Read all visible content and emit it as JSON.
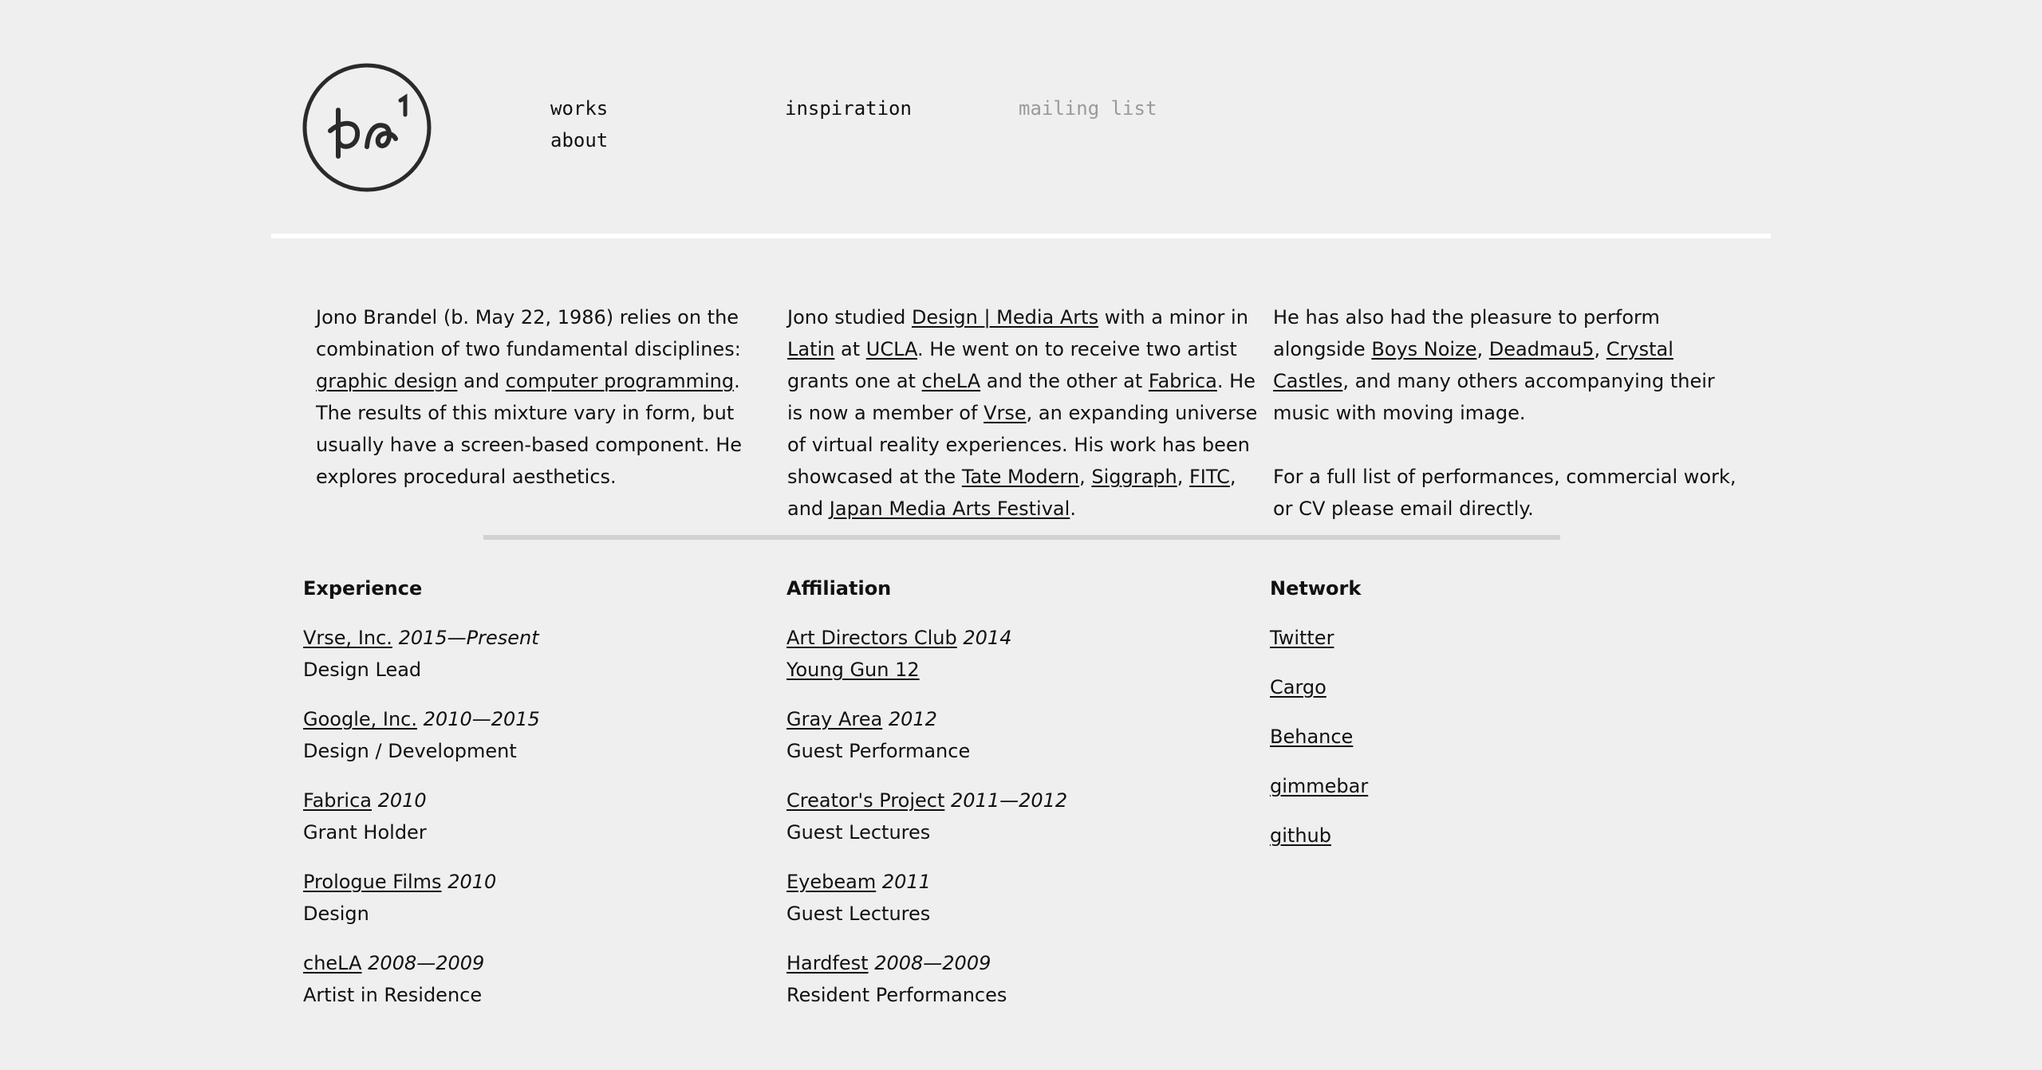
{
  "logo": {
    "icon": "circle-monogram-logo"
  },
  "nav": {
    "works": "works",
    "about": "about",
    "inspiration": "inspiration",
    "mailing_list": "mailing list"
  },
  "intro": {
    "col1": {
      "t1": "Jono Brandel (b. May 22, 1986) relies on the combination of two fundamental disciplines: ",
      "link_graphic_design": "graphic design",
      "t2": " and ",
      "link_computer_programming": "computer programming",
      "t3": ". The results of this mixture vary in form, but usually have a screen-based component. He explores procedural aesthetics."
    },
    "col2": {
      "t1": "Jono studied ",
      "link_design_media_arts": "Design | Media Arts",
      "t2": " with a minor in ",
      "link_latin": "Latin",
      "t3": " at ",
      "link_ucla": "UCLA",
      "t4": ". He went on to receive two artist grants one at ",
      "link_chela": "cheLA",
      "t5": " and the other at ",
      "link_fabrica": "Fabrica",
      "t6": ". He is now a member of ",
      "link_vrse": "Vrse",
      "t7": ", an expanding universe of virtual reality experiences. His work has been showcased at the ",
      "link_tate_modern": "Tate Modern",
      "t8": ", ",
      "link_siggraph": "Siggraph",
      "t9": ", ",
      "link_fitc": "FITC",
      "t10": ", and ",
      "link_japan_media_arts": "Japan Media Arts Festival",
      "t11": "."
    },
    "col3": {
      "t1": "He has also had the pleasure to perform alongside ",
      "link_boys_noize": "Boys Noize",
      "t2": ", ",
      "link_deadmau5": "Deadmau5",
      "t3": ", ",
      "link_crystal_castles": "Crystal Castles",
      "t4": ", and many others accompanying their music with moving image.",
      "p2": "For a full list of performances, commercial work, or CV please email directly."
    }
  },
  "experience": {
    "heading": "Experience",
    "items": [
      {
        "name": "Vrse, Inc.",
        "years": "2015—Present",
        "role": "Design Lead"
      },
      {
        "name": "Google, Inc.",
        "years": "2010—2015",
        "role": "Design / Development"
      },
      {
        "name": "Fabrica",
        "years": "2010",
        "role": "Grant Holder"
      },
      {
        "name": "Prologue Films",
        "years": "2010",
        "role": "Design"
      },
      {
        "name": "cheLA",
        "years": "2008—2009",
        "role": "Artist in Residence"
      }
    ]
  },
  "affiliation": {
    "heading": "Affiliation",
    "items": [
      {
        "name": "Art Directors Club",
        "years": "2014",
        "role": "Young Gun 12",
        "role_is_link": true
      },
      {
        "name": "Gray Area",
        "years": "2012",
        "role": "Guest Performance"
      },
      {
        "name": "Creator's Project",
        "years": "2011—2012",
        "role": "Guest Lectures"
      },
      {
        "name": "Eyebeam",
        "years": "2011",
        "role": "Guest Lectures"
      },
      {
        "name": "Hardfest",
        "years": "2008—2009",
        "role": "Resident Performances"
      }
    ]
  },
  "network": {
    "heading": "Network",
    "items": [
      "Twitter",
      "Cargo",
      "Behance",
      "gimmebar",
      "github"
    ]
  }
}
